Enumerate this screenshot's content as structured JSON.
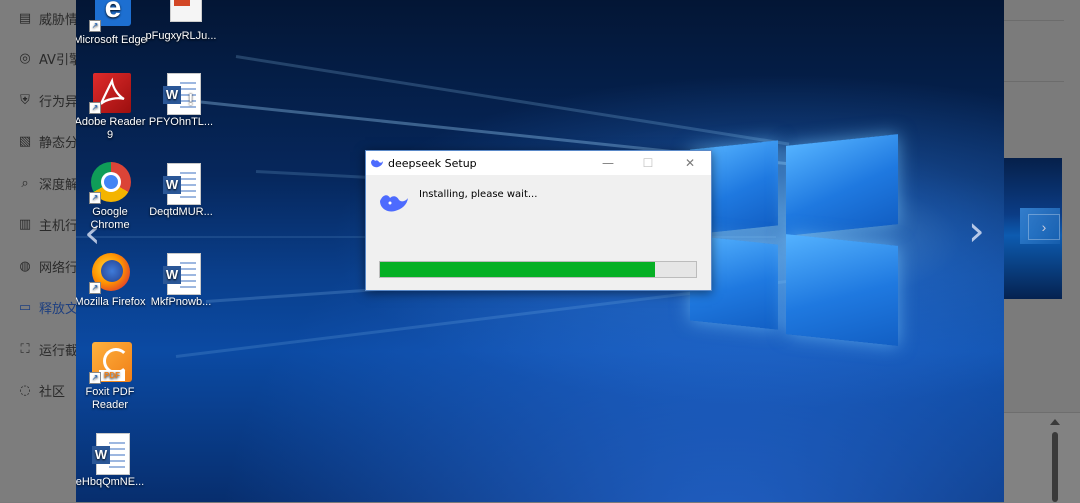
{
  "sidebar": {
    "items": [
      {
        "label": "威胁情",
        "icon": "document-icon"
      },
      {
        "label": "AV引擎",
        "icon": "target-icon"
      },
      {
        "label": "行为异",
        "icon": "shield-icon"
      },
      {
        "label": "静态分",
        "icon": "file-analysis-icon"
      },
      {
        "label": "深度解",
        "icon": "search-icon"
      },
      {
        "label": "主机行",
        "icon": "host-icon"
      },
      {
        "label": "网络行",
        "icon": "globe-icon"
      },
      {
        "label": "释放文",
        "icon": "folder-icon"
      },
      {
        "label": "运行截",
        "icon": "screenshot-icon"
      },
      {
        "label": "社区",
        "icon": "chat-icon"
      }
    ],
    "active_index": 7,
    "active_color": "#1d3f80"
  },
  "desktop": {
    "icons": [
      {
        "label": "Microsoft Edge",
        "icon": "edge-icon"
      },
      {
        "label": "pFugxyRLJu...",
        "icon": "powerpoint-doc-icon"
      },
      {
        "label": "Adobe Reader 9",
        "icon": "adobe-reader-icon"
      },
      {
        "label": "PFYOhnTL...",
        "icon": "word-doc-icon"
      },
      {
        "label": "Google Chrome",
        "icon": "chrome-icon"
      },
      {
        "label": "DeqtdMUR...",
        "icon": "word-doc-icon"
      },
      {
        "label": "Mozilla Firefox",
        "icon": "firefox-icon"
      },
      {
        "label": "MkfPnowb...",
        "icon": "word-doc-icon"
      },
      {
        "label": "Foxit PDF Reader",
        "icon": "foxit-pdf-icon"
      },
      {
        "label": "eHbqQmNE...",
        "icon": "word-doc-icon"
      }
    ]
  },
  "dialog": {
    "title": "deepseek Setup",
    "message": "Installing, please wait...",
    "progress": 0.87,
    "progress_color": "#06b025",
    "minimize_label": "—",
    "maximize_label": "☐",
    "close_label": "✕"
  },
  "navigation": {
    "prev_label": "‹",
    "next_label": "›"
  },
  "right_panel": {
    "thumb_next_label": "›"
  }
}
